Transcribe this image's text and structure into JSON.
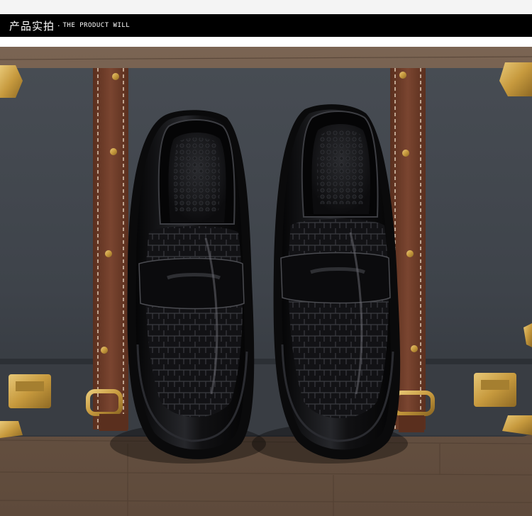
{
  "header": {
    "title": "产品实拍",
    "separator": "·",
    "subtitle": "THE PRODUCT WILL"
  },
  "photo": {
    "subject": "photo-shoes",
    "colors": {
      "wood": "#6b5646",
      "suitcase": "#3f444b",
      "strap": "#6e3b27",
      "hardware": "#c9a24a",
      "leather": "#0d0d0f"
    }
  }
}
